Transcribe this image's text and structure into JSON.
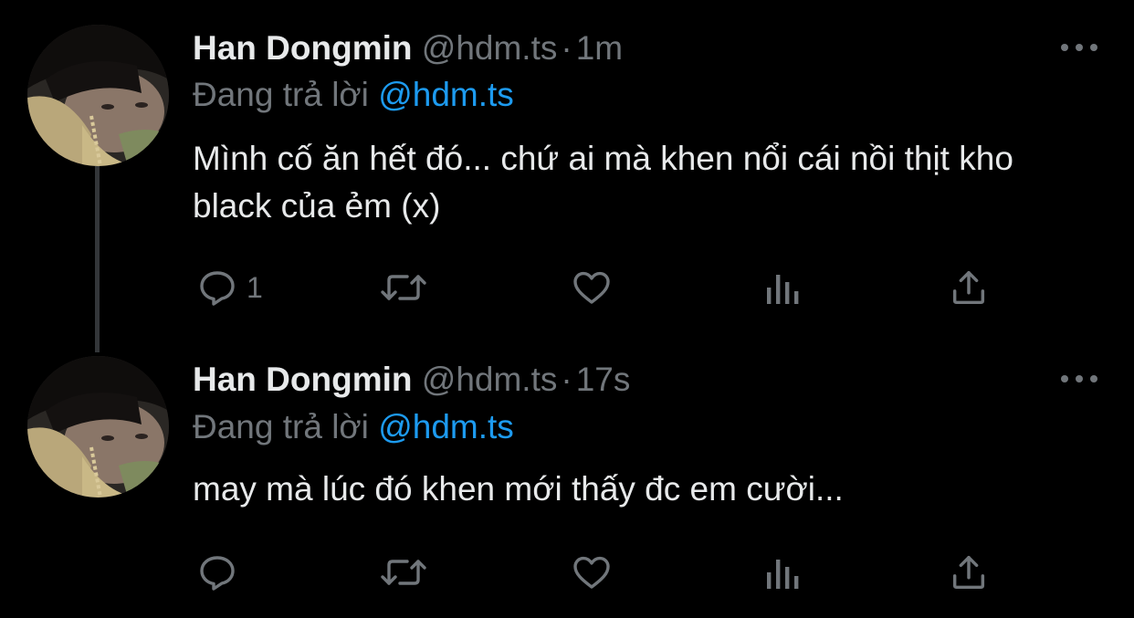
{
  "tweets": [
    {
      "author_name": "Han Dongmin",
      "handle": "@hdm.ts",
      "separator": "·",
      "time": "1m",
      "reply_prefix": "Đang trả lời",
      "reply_mention": "@hdm.ts",
      "text": "Mình cố ăn hết đó... chứ ai mà khen nổi cái nồi thịt kho black của ẻm (x)",
      "reply_count": "1",
      "icons": [
        "reply-icon",
        "retweet-icon",
        "like-icon",
        "views-icon",
        "share-icon"
      ]
    },
    {
      "author_name": "Han Dongmin",
      "handle": "@hdm.ts",
      "separator": "·",
      "time": "17s",
      "reply_prefix": "Đang trả lời",
      "reply_mention": "@hdm.ts",
      "text": "may mà lúc đó khen mới thấy đc em cười...",
      "reply_count": "",
      "icons": [
        "reply-icon",
        "retweet-icon",
        "like-icon",
        "views-icon",
        "share-icon"
      ]
    }
  ],
  "colors": {
    "background": "#000000",
    "primary_text": "#e7e9ea",
    "secondary_text": "#71767b",
    "accent": "#1d9bf0",
    "thread_line": "#333639"
  }
}
